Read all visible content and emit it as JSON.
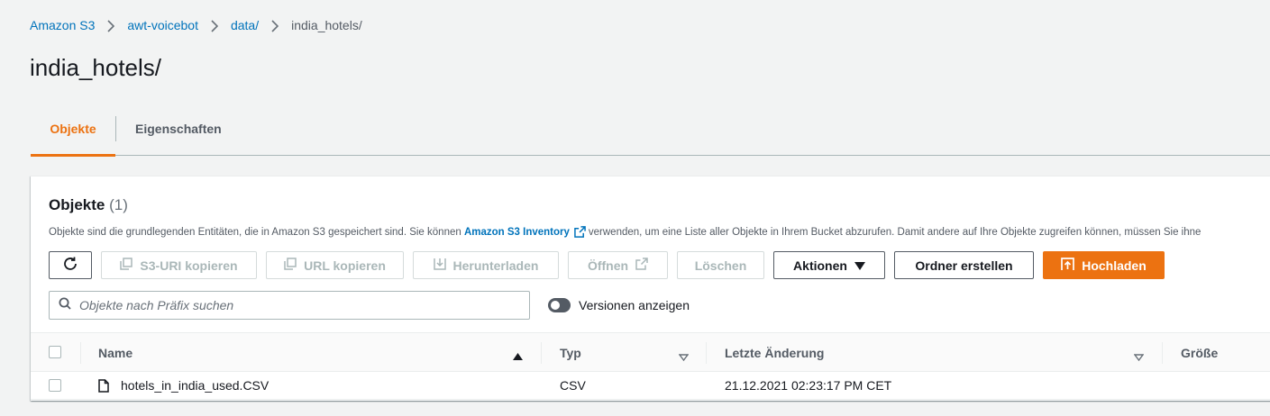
{
  "breadcrumb": [
    "Amazon S3",
    "awt-voicebot",
    "data/",
    "india_hotels/"
  ],
  "page_title": "india_hotels/",
  "tabs": [
    {
      "label": "Objekte",
      "active": true
    },
    {
      "label": "Eigenschaften",
      "active": false
    }
  ],
  "objects": {
    "title": "Objekte",
    "count": "(1)",
    "description_before": "Objekte sind die grundlegenden Entitäten, die in Amazon S3 gespeichert sind. Sie können ",
    "description_link": "Amazon S3 Inventory",
    "description_after": "verwenden, um eine Liste aller Objekte in Ihrem Bucket abzurufen. Damit andere auf Ihre Objekte zugreifen können, müssen Sie ihne",
    "toolbar": {
      "copy_s3_uri": "S3-URI kopieren",
      "copy_url": "URL kopieren",
      "download": "Herunterladen",
      "open": "Öffnen",
      "delete": "Löschen",
      "actions": "Aktionen",
      "create_folder": "Ordner erstellen",
      "upload": "Hochladen"
    },
    "search_placeholder": "Objekte nach Präfix suchen",
    "show_versions_label": "Versionen anzeigen",
    "show_versions": false,
    "columns": [
      "Name",
      "Typ",
      "Letzte Änderung",
      "Größe"
    ],
    "rows": [
      {
        "name": "hotels_in_india_used.CSV",
        "type": "CSV",
        "modified": "21.12.2021 02:23:17 PM CET",
        "size": ""
      }
    ]
  },
  "colors": {
    "accent": "#ec7211",
    "link": "#0073bb",
    "text": "#16191f",
    "secondary_text": "#545b64"
  },
  "icons": [
    "chevron-right-icon",
    "refresh-icon",
    "copy-icon",
    "download-icon",
    "external-link-icon",
    "caret-down-icon",
    "upload-icon",
    "search-icon",
    "sort-ascending-icon",
    "sort-icon",
    "file-icon"
  ]
}
